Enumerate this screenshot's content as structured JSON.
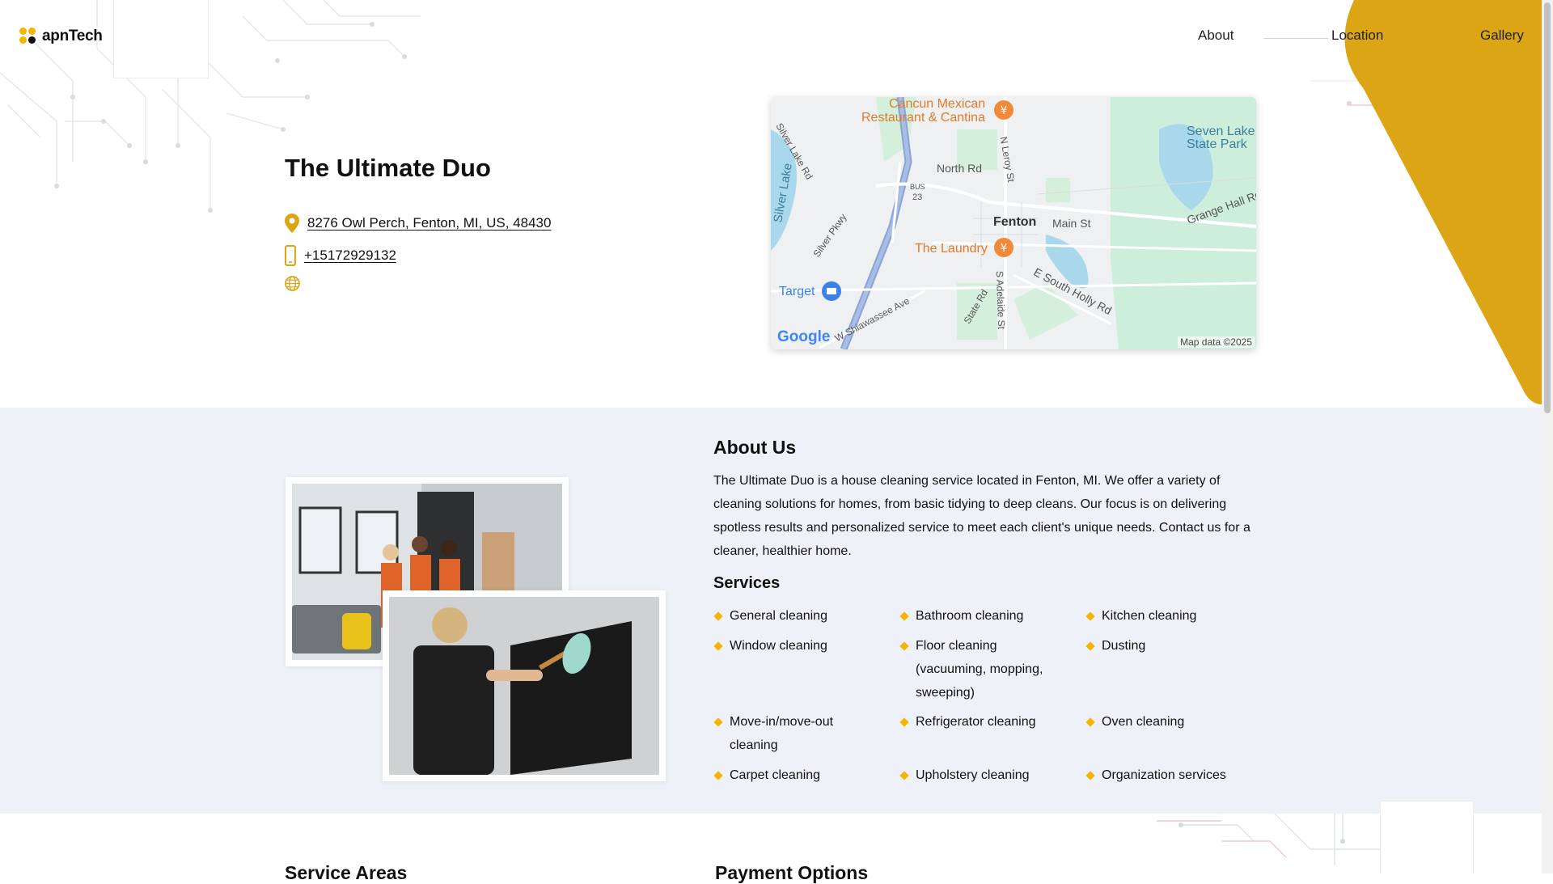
{
  "brand": {
    "name": "apnTech",
    "dot_colors": [
      "#f5b400",
      "#f5b400",
      "#f5b400",
      "#111111"
    ]
  },
  "nav": {
    "items": [
      "About",
      "Location",
      "Gallery"
    ]
  },
  "colors": {
    "accent": "#f5b400",
    "section_bg": "#eef2f8",
    "map_blue": "#4285f4"
  },
  "business": {
    "name": "The Ultimate Duo",
    "address": "8276 Owl Perch, Fenton, MI, US, 48430",
    "phone": "+15172929132",
    "icons": [
      "map-pin-icon",
      "phone-icon",
      "globe-icon"
    ]
  },
  "map": {
    "labels": {
      "cancun": "Cancun Mexican",
      "cancun2": "Restaurant & Cantina",
      "seven": "Seven Lake",
      "seven2": "State Park",
      "silver_lake_rd": "Silver Lake Rd",
      "north_rd": "North Rd",
      "n_leroy": "N Leroy St",
      "bus23": "BUS",
      "bus23_num": "23",
      "silver_lake": "Silver Lake",
      "silver_pkwy": "Silver Pkwy",
      "fenton": "Fenton",
      "main_st": "Main St",
      "grange": "Grange Hall Rd",
      "laundry": "The Laundry",
      "target": "Target",
      "e_south_holly": "E South Holly Rd",
      "state_rd": "State Rd",
      "s_adelaide": "S Adelaide St",
      "w_shiawassee": "W Shiawassee Ave",
      "google": "Google",
      "copyright": "Map data ©2025"
    }
  },
  "about": {
    "title": "About Us",
    "text": "The Ultimate Duo is a house cleaning service located in Fenton, MI. We offer a variety of cleaning solutions for homes, from basic tidying to deep cleans. Our focus is on delivering spotless results and personalized service to meet each client's unique needs. Contact us for a cleaner, healthier home.",
    "services_title": "Services",
    "services": [
      "General cleaning",
      "Bathroom cleaning",
      "Kitchen cleaning",
      "Window cleaning",
      "Floor cleaning (vacuuming, mopping, sweeping)",
      "Dusting",
      "Move-in/move-out cleaning",
      "Refrigerator cleaning",
      "Oven cleaning",
      "Carpet cleaning",
      "Upholstery cleaning",
      "Organization services"
    ]
  },
  "next_section": {
    "left_heading": "Service Areas",
    "right_heading": "Payment Options"
  }
}
